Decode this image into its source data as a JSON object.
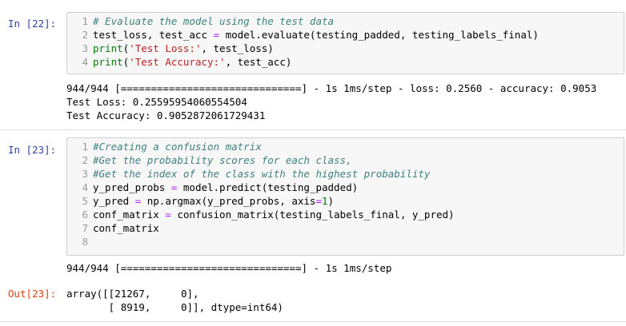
{
  "cells": [
    {
      "prompt": "In [22]:",
      "lines": [
        {
          "num": "1",
          "segments": [
            {
              "t": "# Evaluate the model using the test data",
              "c": "cm"
            }
          ]
        },
        {
          "num": "2",
          "segments": [
            {
              "t": "test_loss, test_acc ",
              "c": ""
            },
            {
              "t": "=",
              "c": "op"
            },
            {
              "t": " model.evaluate(testing_padded, testing_labels_final)",
              "c": ""
            }
          ]
        },
        {
          "num": "3",
          "segments": [
            {
              "t": "print",
              "c": "bi"
            },
            {
              "t": "(",
              "c": ""
            },
            {
              "t": "'Test Loss:'",
              "c": "st"
            },
            {
              "t": ", test_loss)",
              "c": ""
            }
          ]
        },
        {
          "num": "4",
          "segments": [
            {
              "t": "print",
              "c": "bi"
            },
            {
              "t": "(",
              "c": ""
            },
            {
              "t": "'Test Accuracy:'",
              "c": "st"
            },
            {
              "t": ", test_acc)",
              "c": ""
            }
          ]
        }
      ],
      "output": [
        "944/944 [==============================] - 1s 1ms/step - loss: 0.2560 - accuracy: 0.9053",
        "Test Loss: 0.25595954060554504",
        "Test Accuracy: 0.9052872061729431"
      ]
    },
    {
      "prompt": "In [23]:",
      "lines": [
        {
          "num": "1",
          "segments": [
            {
              "t": "#Creating a confusion matrix",
              "c": "cm"
            }
          ]
        },
        {
          "num": "2",
          "segments": [
            {
              "t": "#Get the probability scores for each class,",
              "c": "cm"
            }
          ]
        },
        {
          "num": "3",
          "segments": [
            {
              "t": "#Get the index of the class with the highest probability",
              "c": "cm"
            }
          ]
        },
        {
          "num": "4",
          "segments": [
            {
              "t": "y_pred_probs ",
              "c": ""
            },
            {
              "t": "=",
              "c": "op"
            },
            {
              "t": " model.predict(testing_padded)",
              "c": ""
            }
          ]
        },
        {
          "num": "5",
          "segments": [
            {
              "t": "y_pred ",
              "c": ""
            },
            {
              "t": "=",
              "c": "op"
            },
            {
              "t": " np.argmax(y_pred_probs, axis",
              "c": ""
            },
            {
              "t": "=",
              "c": "op"
            },
            {
              "t": "1",
              "c": "nm"
            },
            {
              "t": ")",
              "c": ""
            }
          ]
        },
        {
          "num": "6",
          "segments": [
            {
              "t": "conf_matrix ",
              "c": ""
            },
            {
              "t": "=",
              "c": "op"
            },
            {
              "t": " confusion_matrix(testing_labels_final, y_pred)",
              "c": ""
            }
          ]
        },
        {
          "num": "7",
          "segments": [
            {
              "t": "conf_matrix",
              "c": ""
            }
          ]
        },
        {
          "num": "8",
          "segments": []
        }
      ],
      "output": [
        "944/944 [==============================] - 1s 1ms/step"
      ],
      "out_prompt": "Out[23]:",
      "result": [
        "array([[21267,     0],",
        "       [ 8919,     0]], dtype=int64)"
      ]
    }
  ]
}
